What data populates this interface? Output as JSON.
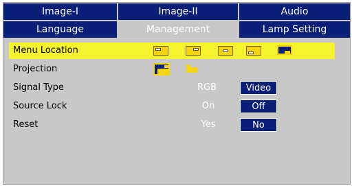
{
  "tabs_row1": [
    "Image-I",
    "Image-II",
    "Audio"
  ],
  "tabs_row2": [
    "Language",
    "Management",
    "Lamp Setting"
  ],
  "active_tab": "Management",
  "colors": {
    "tab_bg": "#0a1f78",
    "panel_bg": "#c8c8c8",
    "highlight": "#f6f22e",
    "icon_yellow": "#f6d40a"
  },
  "menu": {
    "menu_location": {
      "label": "Menu Location",
      "icons": [
        "top-left-position-icon",
        "top-right-position-icon",
        "center-position-icon",
        "bottom-left-position-icon",
        "bottom-right-position-icon"
      ],
      "selected_index": 4
    },
    "projection": {
      "label": "Projection",
      "icons": [
        "ceiling-projection-icon",
        "front-projection-icon"
      ],
      "selected_index": 0
    },
    "signal_type": {
      "label": "Signal Type",
      "options": [
        "RGB",
        "Video"
      ],
      "selected": "Video"
    },
    "source_lock": {
      "label": "Source Lock",
      "options": [
        "On",
        "Off"
      ],
      "selected": "Off"
    },
    "reset": {
      "label": "Reset",
      "options": [
        "Yes",
        "No"
      ],
      "selected": "No"
    }
  }
}
